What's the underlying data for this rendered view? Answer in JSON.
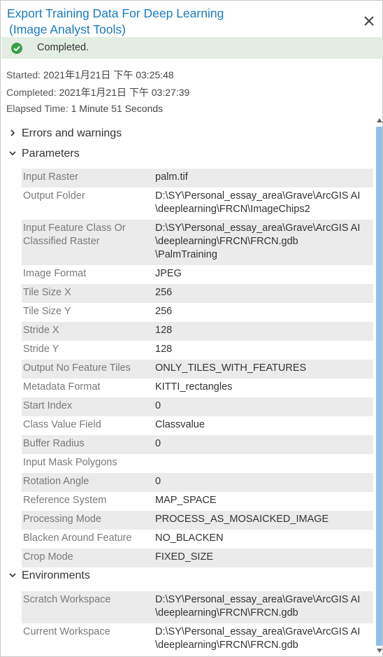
{
  "window": {
    "title_line1": "Export Training Data For Deep Learning",
    "title_line2": "(Image Analyst Tools)",
    "close_icon": "close-icon"
  },
  "status": {
    "icon": "check-circle-icon",
    "text": "Completed.",
    "color": "#3a9f4a"
  },
  "meta": {
    "started_label": "Started:",
    "started_value": "2021年1月21日 下午 03:25:48",
    "completed_label": "Completed:",
    "completed_value": "2021年1月21日 下午 03:27:39",
    "elapsed_label": "Elapsed Time:",
    "elapsed_value": "1 Minute 51 Seconds"
  },
  "sections": {
    "errors": "Errors and warnings",
    "parameters": "Parameters",
    "environments": "Environments"
  },
  "parameters": [
    {
      "key": "Input Raster",
      "value": "palm.tif"
    },
    {
      "key": "Output Folder",
      "value": "D:\\SY\\Personal_essay_area\\Grave\\ArcGIS AI\n\\deeplearning\\FRCN\\ImageChips2"
    },
    {
      "key": "Input Feature Class Or\nClassified Raster",
      "value": "D:\\SY\\Personal_essay_area\\Grave\\ArcGIS AI\n\\deeplearning\\FRCN\\FRCN.gdb\n\\PalmTraining"
    },
    {
      "key": "Image Format",
      "value": "JPEG"
    },
    {
      "key": "Tile Size X",
      "value": "256"
    },
    {
      "key": "Tile Size Y",
      "value": "256"
    },
    {
      "key": "Stride X",
      "value": "128"
    },
    {
      "key": "Stride Y",
      "value": "128"
    },
    {
      "key": "Output No Feature Tiles",
      "value": "ONLY_TILES_WITH_FEATURES"
    },
    {
      "key": "Metadata Format",
      "value": "KITTI_rectangles"
    },
    {
      "key": "Start Index",
      "value": "0"
    },
    {
      "key": "Class Value Field",
      "value": "Classvalue"
    },
    {
      "key": "Buffer Radius",
      "value": "0"
    },
    {
      "key": "Input Mask Polygons",
      "value": ""
    },
    {
      "key": "Rotation Angle",
      "value": "0"
    },
    {
      "key": "Reference System",
      "value": "MAP_SPACE"
    },
    {
      "key": "Processing Mode",
      "value": "PROCESS_AS_MOSAICKED_IMAGE"
    },
    {
      "key": "Blacken Around Feature",
      "value": "NO_BLACKEN"
    },
    {
      "key": "Crop Mode",
      "value": "FIXED_SIZE"
    }
  ],
  "environments": [
    {
      "key": "Scratch Workspace",
      "value": "D:\\SY\\Personal_essay_area\\Grave\\ArcGIS AI\n\\deeplearning\\FRCN\\FRCN.gdb"
    },
    {
      "key": "Current Workspace",
      "value": "D:\\SY\\Personal_essay_area\\Grave\\ArcGIS AI\n\\deeplearning\\FRCN\\FRCN.gdb"
    }
  ]
}
